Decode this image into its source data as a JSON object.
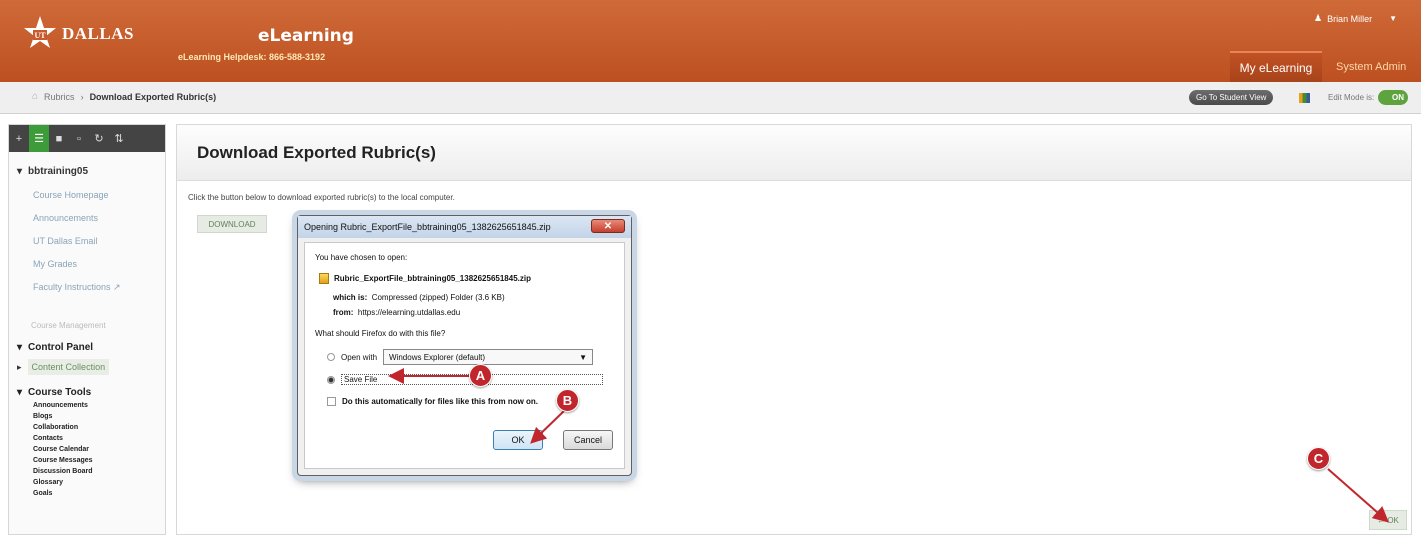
{
  "header": {
    "logo_text": "DALLAS",
    "logo_mark": "UT",
    "site_title": "eLearning",
    "helpdesk": "eLearning Helpdesk: 866-588-3192",
    "user_name": "Brian Miller",
    "tabs": [
      "My eLearning",
      "System Admin"
    ]
  },
  "breadcrumb": {
    "items": [
      "Rubrics",
      "Download Exported Rubric(s)"
    ],
    "student_view": "Go To Student View",
    "edit_mode_label": "Edit Mode is:",
    "edit_mode_state": "ON"
  },
  "sidebar": {
    "course": "bbtraining05",
    "links": [
      "Course Homepage",
      "Announcements",
      "UT Dallas Email",
      "My Grades",
      "Faculty Instructions"
    ],
    "divider_label": "Course Management",
    "control_panel": "Control Panel",
    "content_collection": "Content Collection",
    "course_tools": "Course Tools",
    "tools": [
      "Announcements",
      "Blogs",
      "Collaboration",
      "Contacts",
      "Course Calendar",
      "Course Messages",
      "Discussion Board",
      "Glossary",
      "Goals"
    ]
  },
  "main": {
    "page_title": "Download Exported Rubric(s)",
    "instructions": "Click the button below to download exported rubric(s) to the local computer.",
    "download_label": "DOWNLOAD",
    "ok_label": "OK"
  },
  "dialog": {
    "title": "Opening Rubric_ExportFile_bbtraining05_1382625651845.zip",
    "chosen": "You have chosen to open:",
    "filename": "Rubric_ExportFile_bbtraining05_1382625651845.zip",
    "which_label": "which is:",
    "which_value": "Compressed (zipped) Folder (3.6 KB)",
    "from_label": "from:",
    "from_value": "https://elearning.utdallas.edu",
    "question": "What should Firefox do with this file?",
    "open_with": "Open with",
    "app": "Windows Explorer (default)",
    "save_file": "Save File",
    "auto": "Do this automatically for files like this from now on.",
    "ok": "OK",
    "cancel": "Cancel"
  },
  "callouts": [
    "A",
    "B",
    "C"
  ],
  "colors": {
    "header": "#c75b2c",
    "accent_green": "#3d9b3a",
    "callout": "#c1262c"
  }
}
